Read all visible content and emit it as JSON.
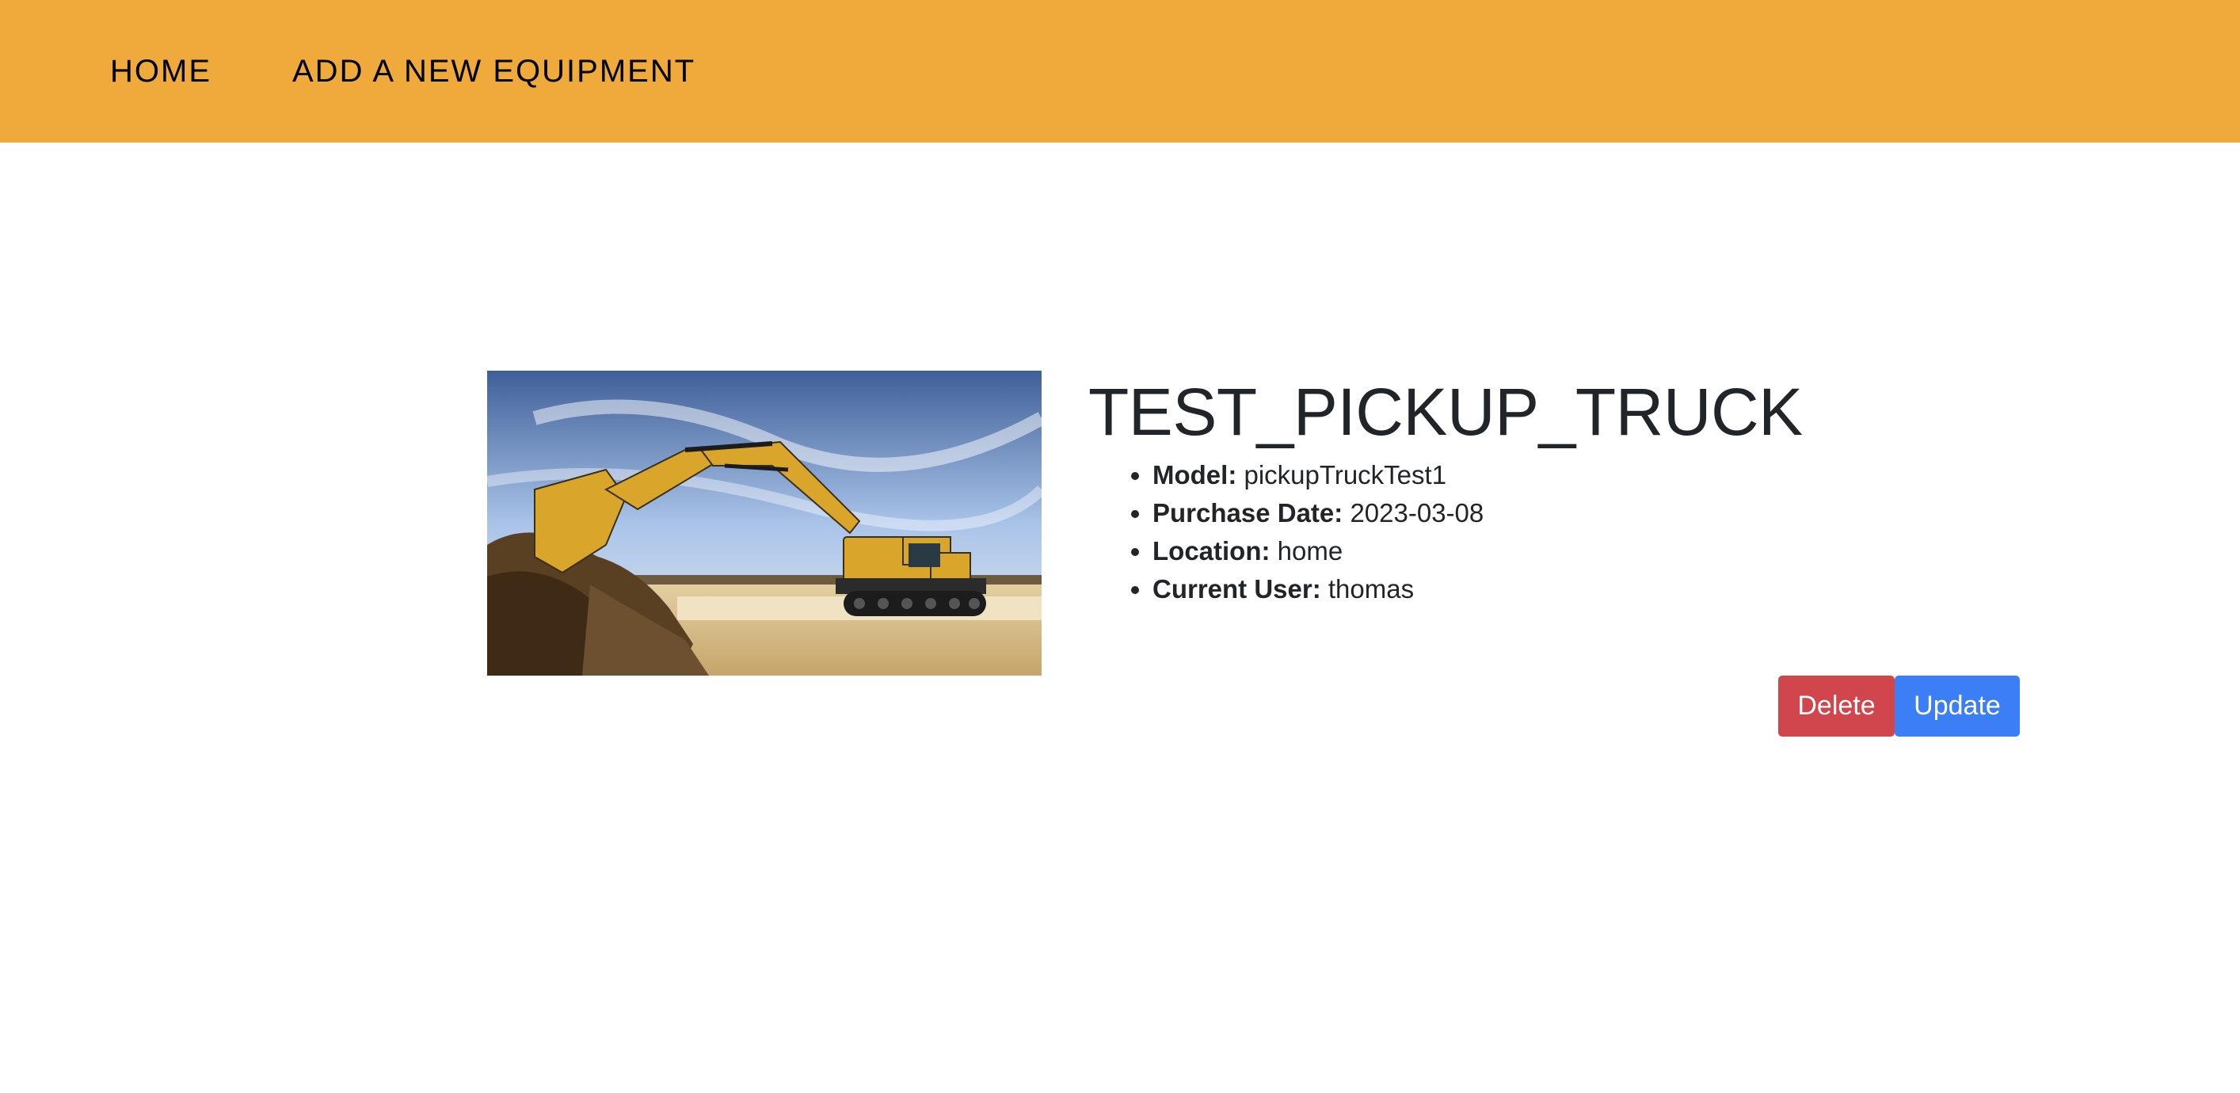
{
  "colors": {
    "navbar_bg": "#f0a93b",
    "delete_bg": "#d0464c",
    "update_bg": "#3c7ef5"
  },
  "nav": {
    "home": "HOME",
    "add_equipment": "ADD A NEW EQUIPMENT"
  },
  "equipment": {
    "image_alt": "excavator",
    "name": "TEST_PICKUP_TRUCK",
    "specs": [
      {
        "label": "Model:",
        "value": "pickupTruckTest1"
      },
      {
        "label": "Purchase Date:",
        "value": "2023-03-08"
      },
      {
        "label": "Location:",
        "value": "home"
      },
      {
        "label": "Current User:",
        "value": "thomas"
      }
    ]
  },
  "actions": {
    "delete_label": "Delete",
    "update_label": "Update"
  }
}
